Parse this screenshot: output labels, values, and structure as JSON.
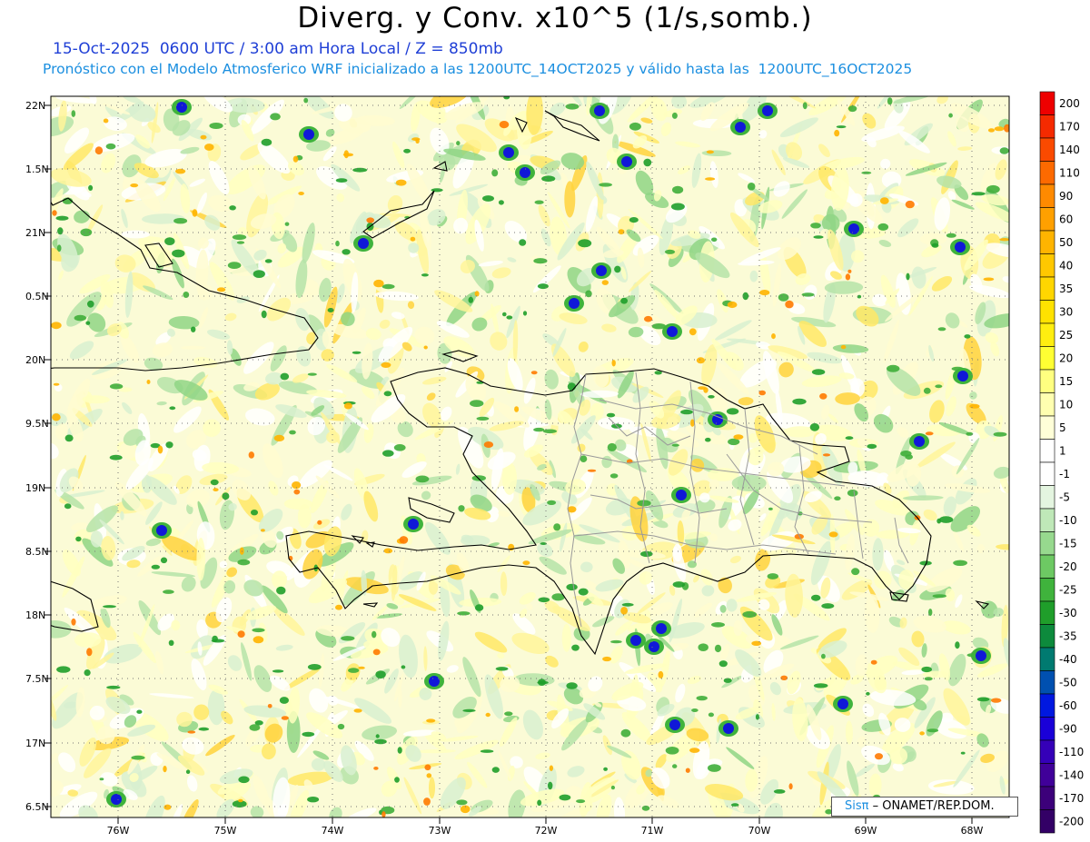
{
  "header": {
    "title": "Diverg. y Conv. x10^5 (1/s,somb.)",
    "date_line": "15-Oct-2025  0600 UTC / 3:00 am Hora Local / Z = 850mb",
    "model_line": "Pronóstico con el Modelo Atmosferico WRF inicializado a las 1200UTC_14OCT2025 y válido hasta las  1200UTC_16OCT2025"
  },
  "map": {
    "lat_labels": [
      "22N",
      "1.5N",
      "21N",
      "0.5N",
      "20N",
      "9.5N",
      "19N",
      "8.5N",
      "18N",
      "7.5N",
      "17N",
      "6.5N"
    ],
    "lon_labels": [
      "76W",
      "75W",
      "74W",
      "73W",
      "72W",
      "71W",
      "70W",
      "69W",
      "68W"
    ]
  },
  "colorbar": {
    "labels": [
      "200",
      "170",
      "140",
      "110",
      "90",
      "60",
      "50",
      "40",
      "35",
      "30",
      "25",
      "20",
      "15",
      "10",
      "5",
      "1",
      "-1",
      "-5",
      "-10",
      "-15",
      "-20",
      "-25",
      "-30",
      "-35",
      "-40",
      "-50",
      "-60",
      "-90",
      "-110",
      "-140",
      "-170",
      "-200"
    ],
    "colors": [
      "#ee0000",
      "#f52a00",
      "#fa4a00",
      "#fd6a00",
      "#ff8a00",
      "#ffa000",
      "#ffb400",
      "#ffc800",
      "#ffd600",
      "#ffe200",
      "#ffee10",
      "#ffff33",
      "#ffff80",
      "#ffffb0",
      "#ffffd8",
      "#ffffff",
      "#ffffff",
      "#e4f5e0",
      "#bfe8b8",
      "#97d98e",
      "#6dc963",
      "#3fb33c",
      "#1f9e2a",
      "#0d8a3c",
      "#007a70",
      "#0050b0",
      "#0018e0",
      "#1a00d8",
      "#3500b8",
      "#400099",
      "#3c007a",
      "#330066"
    ]
  },
  "credit": {
    "sis": "Sisπ",
    "org": " – ONAMET/REP.DOM."
  }
}
